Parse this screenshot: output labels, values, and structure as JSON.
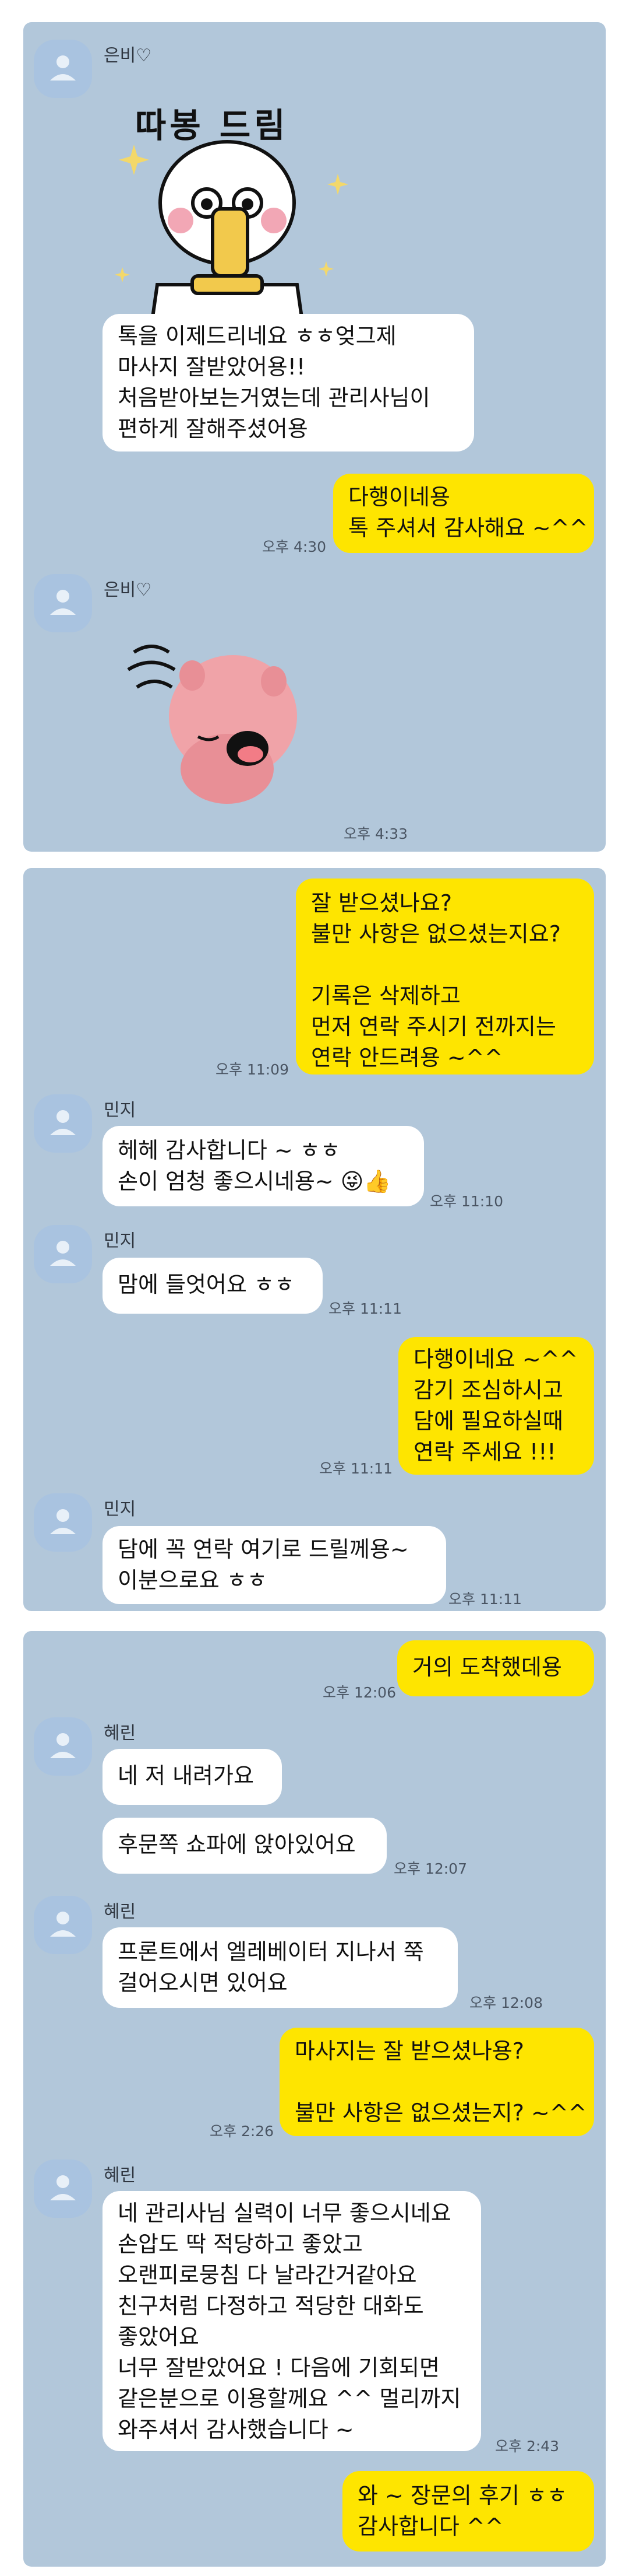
{
  "panel1": {
    "sender": "은비♡",
    "sticker_text": "따봉 드림",
    "msg1": "톡을 이제드리네요 ㅎㅎ엊그제\n마사지 잘받았어용!!\n처음받아보는거였는데 관리사님이\n편하게 잘해주셨어용",
    "reply": "다행이네용\n톡 주셔서 감사해요 ~^^",
    "reply_time": "오후 4:30",
    "sender2": "은비♡",
    "sticker2_time": "오후 4:33"
  },
  "panel2": {
    "out1": "잘 받으셨나요?\n불만 사항은 없으셨는지요?\n\n기록은 삭제하고\n먼저 연락 주시기 전까지는\n연락 안드려용 ~^^",
    "out1_time": "오후 11:09",
    "sender": "민지",
    "in1": "헤헤 감사합니다 ~ ㅎㅎ\n손이 엄청 좋으시네용~ 😜👍",
    "in1_time": "오후 11:10",
    "sender2": "민지",
    "in2": "맘에 들엇어요 ㅎㅎ",
    "in2_time": "오후 11:11",
    "out2": "다행이네요 ~^^\n감기 조심하시고\n담에 필요하실때\n연락 주세요 !!!",
    "out2_time": "오후 11:11",
    "sender3": "민지",
    "in3": "담에 꼭 연락 여기로 드릴께용~\n이분으로요 ㅎㅎ",
    "in3_time": "오후 11:11"
  },
  "panel3": {
    "out1": "거의 도착했데용",
    "out1_time": "오후 12:06",
    "sender": "혜린",
    "in1": "네 저 내려가요",
    "in2": "후문쪽 쇼파에 앉아있어요",
    "in2_time": "오후 12:07",
    "sender2": "혜린",
    "in3": "프론트에서 엘레베이터 지나서 쭉\n걸어오시면 있어요",
    "in3_time": "오후 12:08",
    "out2": "마사지는 잘 받으셨나용?\n\n불만 사항은 없으셨는지? ~^^",
    "out2_time": "오후 2:26",
    "sender3": "혜린",
    "in4": "네 관리사님 실력이 너무 좋으시네요\n손압도 딱 적당하고 좋았고\n오랜피로뭉침 다 날라간거같아요\n친구처럼 다정하고 적당한 대화도\n좋았어요\n너무 잘받았어요 ! 다음에 기회되면\n같은분으로 이용할께요 ^^ 멀리까지\n와주셔서 감사했습니다 ~",
    "in4_time": "오후 2:43",
    "out3": "와 ~ 장문의 후기 ㅎㅎ\n감사합니다 ^^",
    "colors": {
      "panel_bg": "#b2c7da",
      "out_bubble": "#fee500",
      "in_bubble": "#ffffff",
      "avatar": "#a9c3e0"
    }
  }
}
